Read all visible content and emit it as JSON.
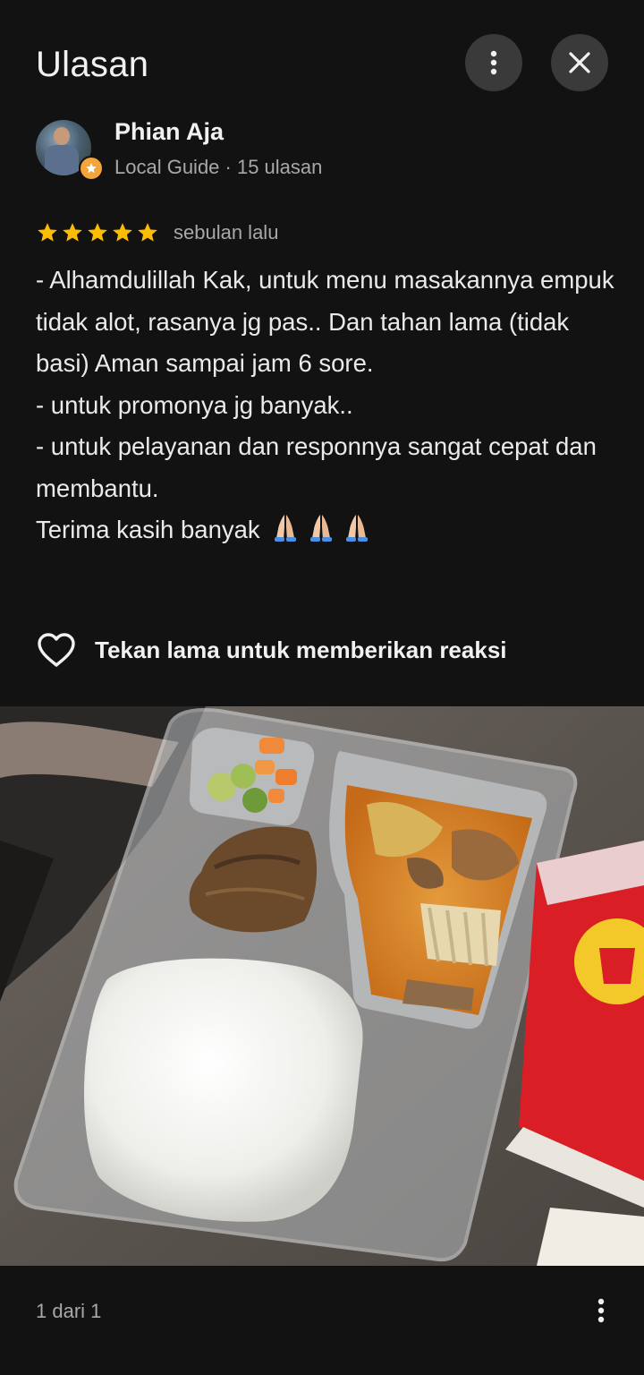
{
  "header": {
    "title": "Ulasan",
    "more_icon": "more-vert-icon",
    "close_icon": "close-icon"
  },
  "author": {
    "name": "Phian Aja",
    "meta": "Local Guide · 15 ulasan",
    "badge_icon": "local-guide-star-icon"
  },
  "review": {
    "rating": 5,
    "rating_max": 5,
    "relative_time": "sebulan lalu",
    "lines": [
      "- Alhamdulillah Kak, untuk menu masakannya empuk tidak alot, rasanya jg pas.. Dan tahan lama (tidak basi) Aman sampai jam 6 sore.",
      "- untuk promonya jg banyak..",
      "- untuk pelayanan dan responnya sangat cepat dan membantu.",
      "Terima kasih banyak"
    ],
    "emoji": [
      "folded-hands",
      "folded-hands",
      "folded-hands"
    ]
  },
  "reaction": {
    "label": "Tekan lama untuk memberikan reaksi",
    "icon": "heart-outline-icon"
  },
  "photo": {
    "subject": "food-photo"
  },
  "footer": {
    "page_indicator": "1 dari 1",
    "more_icon": "more-vert-icon"
  },
  "colors": {
    "background": "#121212",
    "star": "#fbbc04",
    "button_bg": "#3a3a3a",
    "secondary_text": "#a8a8a8"
  }
}
